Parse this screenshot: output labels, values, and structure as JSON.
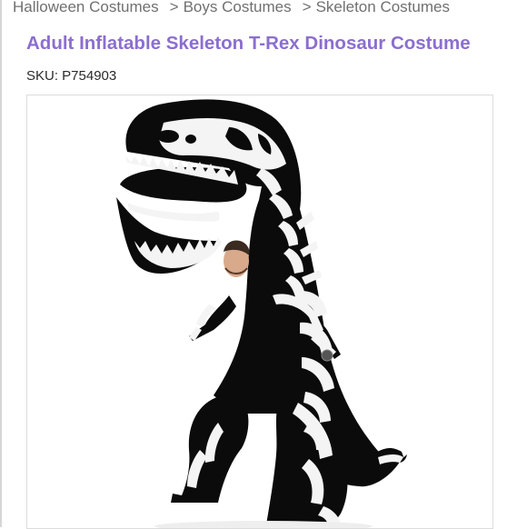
{
  "breadcrumb": {
    "items": [
      "Halloween Costumes",
      "Boys Costumes",
      "Skeleton Costumes"
    ],
    "separator": ">"
  },
  "product": {
    "title": "Adult Inflatable Skeleton T-Rex Dinosaur Costume",
    "sku": "SKU: P754903"
  },
  "colors": {
    "title": "#8b6ed0",
    "breadcrumb": "#707070",
    "costume_body": "#0b0b0c",
    "bones": "#f4f4f4"
  }
}
